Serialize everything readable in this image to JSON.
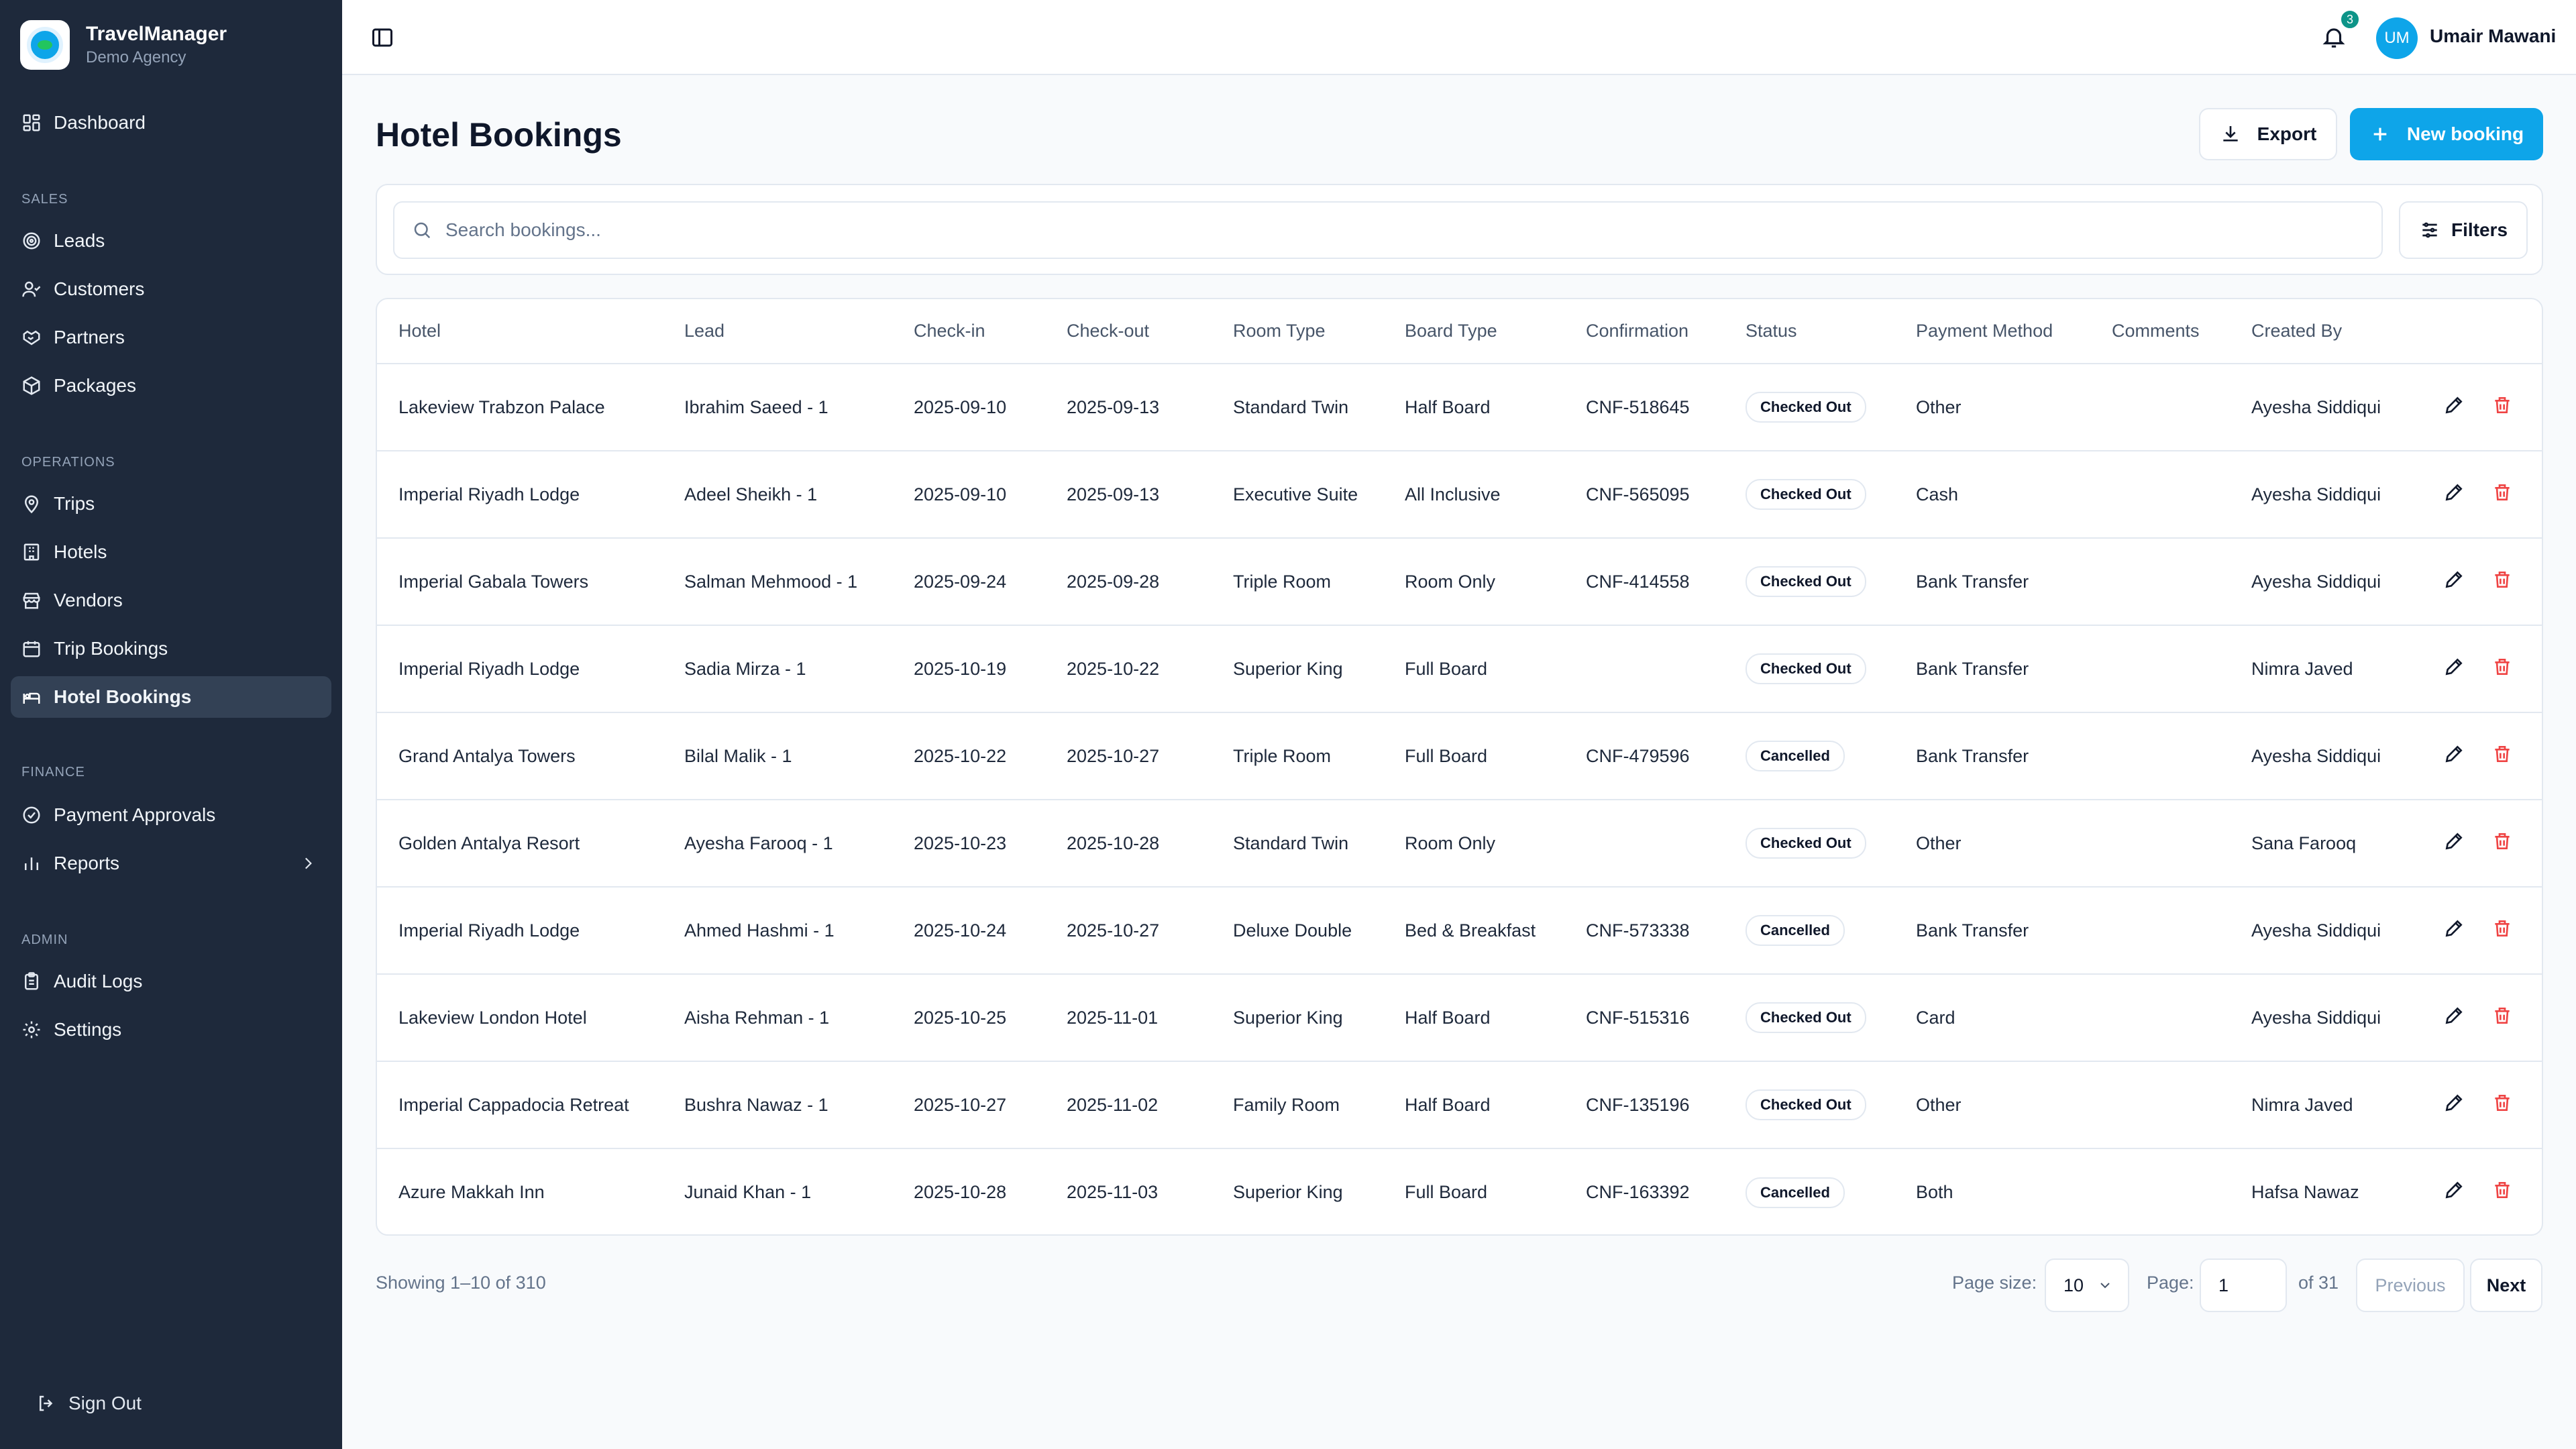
{
  "brand": {
    "name": "TravelManager",
    "subtitle": "Demo Agency"
  },
  "nav": {
    "dashboard": "Dashboard",
    "sections": {
      "sales": "SALES",
      "operations": "OPERATIONS",
      "finance": "FINANCE",
      "admin": "ADMIN"
    },
    "leads": "Leads",
    "customers": "Customers",
    "partners": "Partners",
    "packages": "Packages",
    "trips": "Trips",
    "hotels": "Hotels",
    "vendors": "Vendors",
    "trip_bookings": "Trip Bookings",
    "hotel_bookings": "Hotel Bookings",
    "payment_approvals": "Payment Approvals",
    "reports": "Reports",
    "audit_logs": "Audit Logs",
    "settings": "Settings",
    "sign_out": "Sign Out",
    "active": "hotel_bookings"
  },
  "topbar": {
    "notification_count": "3",
    "user_initials": "UM",
    "user_name": "Umair Mawani"
  },
  "page": {
    "title": "Hotel Bookings",
    "export_label": "Export",
    "new_booking_label": "New booking",
    "search_placeholder": "Search bookings...",
    "filters_label": "Filters"
  },
  "table": {
    "columns": [
      "Hotel",
      "Lead",
      "Check-in",
      "Check-out",
      "Room Type",
      "Board Type",
      "Confirmation",
      "Status",
      "Payment Method",
      "Comments",
      "Created By"
    ],
    "rows": [
      {
        "hotel": "Lakeview Trabzon Palace",
        "lead": "Ibrahim Saeed - 1",
        "checkin": "2025-09-10",
        "checkout": "2025-09-13",
        "room": "Standard Twin",
        "board": "Half Board",
        "confirmation": "CNF-518645",
        "status": "Checked Out",
        "payment": "Other",
        "comments": "",
        "created_by": "Ayesha Siddiqui"
      },
      {
        "hotel": "Imperial Riyadh Lodge",
        "lead": "Adeel Sheikh - 1",
        "checkin": "2025-09-10",
        "checkout": "2025-09-13",
        "room": "Executive Suite",
        "board": "All Inclusive",
        "confirmation": "CNF-565095",
        "status": "Checked Out",
        "payment": "Cash",
        "comments": "",
        "created_by": "Ayesha Siddiqui"
      },
      {
        "hotel": "Imperial Gabala Towers",
        "lead": "Salman Mehmood - 1",
        "checkin": "2025-09-24",
        "checkout": "2025-09-28",
        "room": "Triple Room",
        "board": "Room Only",
        "confirmation": "CNF-414558",
        "status": "Checked Out",
        "payment": "Bank Transfer",
        "comments": "",
        "created_by": "Ayesha Siddiqui"
      },
      {
        "hotel": "Imperial Riyadh Lodge",
        "lead": "Sadia Mirza - 1",
        "checkin": "2025-10-19",
        "checkout": "2025-10-22",
        "room": "Superior King",
        "board": "Full Board",
        "confirmation": "",
        "status": "Checked Out",
        "payment": "Bank Transfer",
        "comments": "",
        "created_by": "Nimra Javed"
      },
      {
        "hotel": "Grand Antalya Towers",
        "lead": "Bilal Malik - 1",
        "checkin": "2025-10-22",
        "checkout": "2025-10-27",
        "room": "Triple Room",
        "board": "Full Board",
        "confirmation": "CNF-479596",
        "status": "Cancelled",
        "payment": "Bank Transfer",
        "comments": "",
        "created_by": "Ayesha Siddiqui"
      },
      {
        "hotel": "Golden Antalya Resort",
        "lead": "Ayesha Farooq - 1",
        "checkin": "2025-10-23",
        "checkout": "2025-10-28",
        "room": "Standard Twin",
        "board": "Room Only",
        "confirmation": "",
        "status": "Checked Out",
        "payment": "Other",
        "comments": "",
        "created_by": "Sana Farooq"
      },
      {
        "hotel": "Imperial Riyadh Lodge",
        "lead": "Ahmed Hashmi - 1",
        "checkin": "2025-10-24",
        "checkout": "2025-10-27",
        "room": "Deluxe Double",
        "board": "Bed & Breakfast",
        "confirmation": "CNF-573338",
        "status": "Cancelled",
        "payment": "Bank Transfer",
        "comments": "",
        "created_by": "Ayesha Siddiqui"
      },
      {
        "hotel": "Lakeview London Hotel",
        "lead": "Aisha Rehman - 1",
        "checkin": "2025-10-25",
        "checkout": "2025-11-01",
        "room": "Superior King",
        "board": "Half Board",
        "confirmation": "CNF-515316",
        "status": "Checked Out",
        "payment": "Card",
        "comments": "",
        "created_by": "Ayesha Siddiqui"
      },
      {
        "hotel": "Imperial Cappadocia Retreat",
        "lead": "Bushra Nawaz - 1",
        "checkin": "2025-10-27",
        "checkout": "2025-11-02",
        "room": "Family Room",
        "board": "Half Board",
        "confirmation": "CNF-135196",
        "status": "Checked Out",
        "payment": "Other",
        "comments": "",
        "created_by": "Nimra Javed"
      },
      {
        "hotel": "Azure Makkah Inn",
        "lead": "Junaid Khan - 1",
        "checkin": "2025-10-28",
        "checkout": "2025-11-03",
        "room": "Superior King",
        "board": "Full Board",
        "confirmation": "CNF-163392",
        "status": "Cancelled",
        "payment": "Both",
        "comments": "",
        "created_by": "Hafsa Nawaz"
      }
    ]
  },
  "pagination": {
    "summary": "Showing 1–10 of 310",
    "page_size_label": "Page size:",
    "page_size": "10",
    "page_label": "Page:",
    "page": "1",
    "of_label": "of 31",
    "previous": "Previous",
    "next": "Next"
  },
  "colors": {
    "sidebar_bg": "#1e293b",
    "accent": "#0ea5e9",
    "delete": "#ef4444",
    "badge_notification": "#0d9488"
  }
}
